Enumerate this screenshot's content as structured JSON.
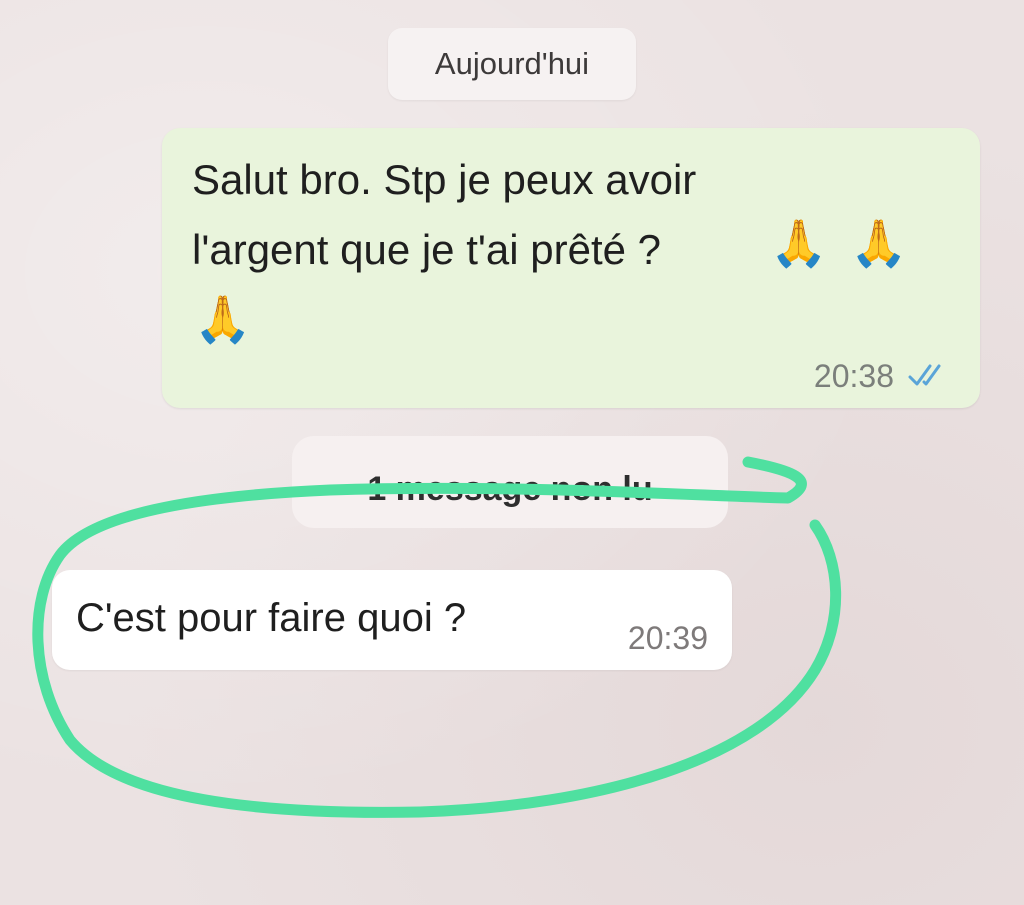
{
  "chat": {
    "date_separator": "Aujourd'hui",
    "outgoing_message": {
      "line_1": "Salut bro. Stp je peux avoir",
      "line_2": "l'argent que je t'ai prêté ?",
      "emoji": "🙏",
      "emoji_count": 3,
      "time": "20:38",
      "status_icon": "double-check-icon"
    },
    "unread_separator": "1 message non lu",
    "incoming_message": {
      "text": "C'est pour faire quoi ?",
      "time": "20:39"
    }
  },
  "colors": {
    "outgoing_bubble": "#e9f4dc",
    "incoming_bubble": "#ffffff",
    "highlight_stroke": "#4fe0a0",
    "read_ticks": "#5aa4d8"
  }
}
